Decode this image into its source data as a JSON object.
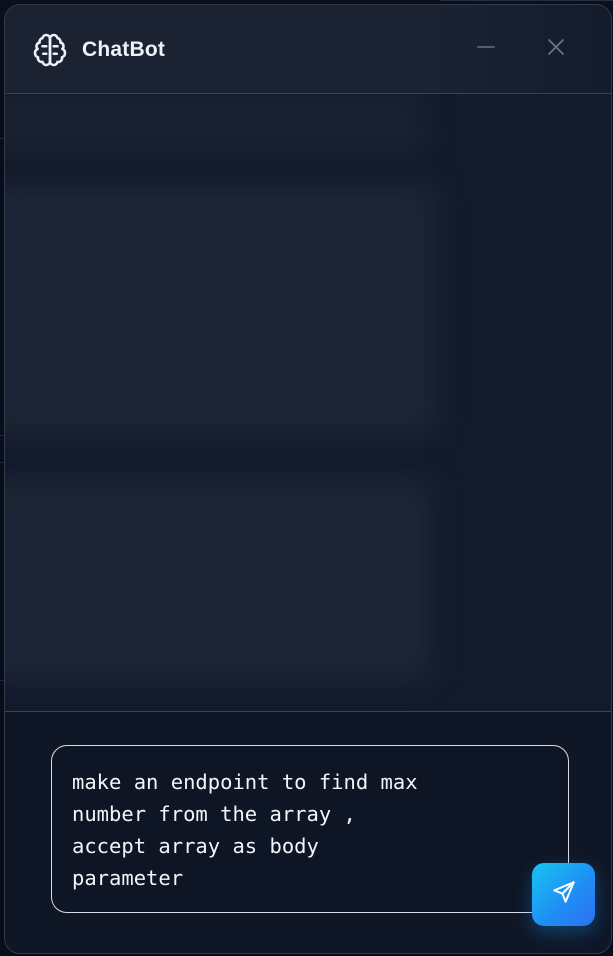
{
  "header": {
    "title": "ChatBot",
    "brand_icon": "brain-icon",
    "minimize_icon": "minus-icon",
    "close_icon": "close-icon"
  },
  "composer": {
    "input_value": "make an endpoint to find max\nnumber from the array ,\naccept array as body\nparameter",
    "send_icon": "send-icon"
  },
  "colors": {
    "background": "#0b1120",
    "panel": "#111a2b",
    "header": "#1b2333",
    "send_gradient_start": "#19c3f0",
    "send_gradient_end": "#2f70f2",
    "input_border": "#d7dce4",
    "text": "#f2f5fa"
  }
}
